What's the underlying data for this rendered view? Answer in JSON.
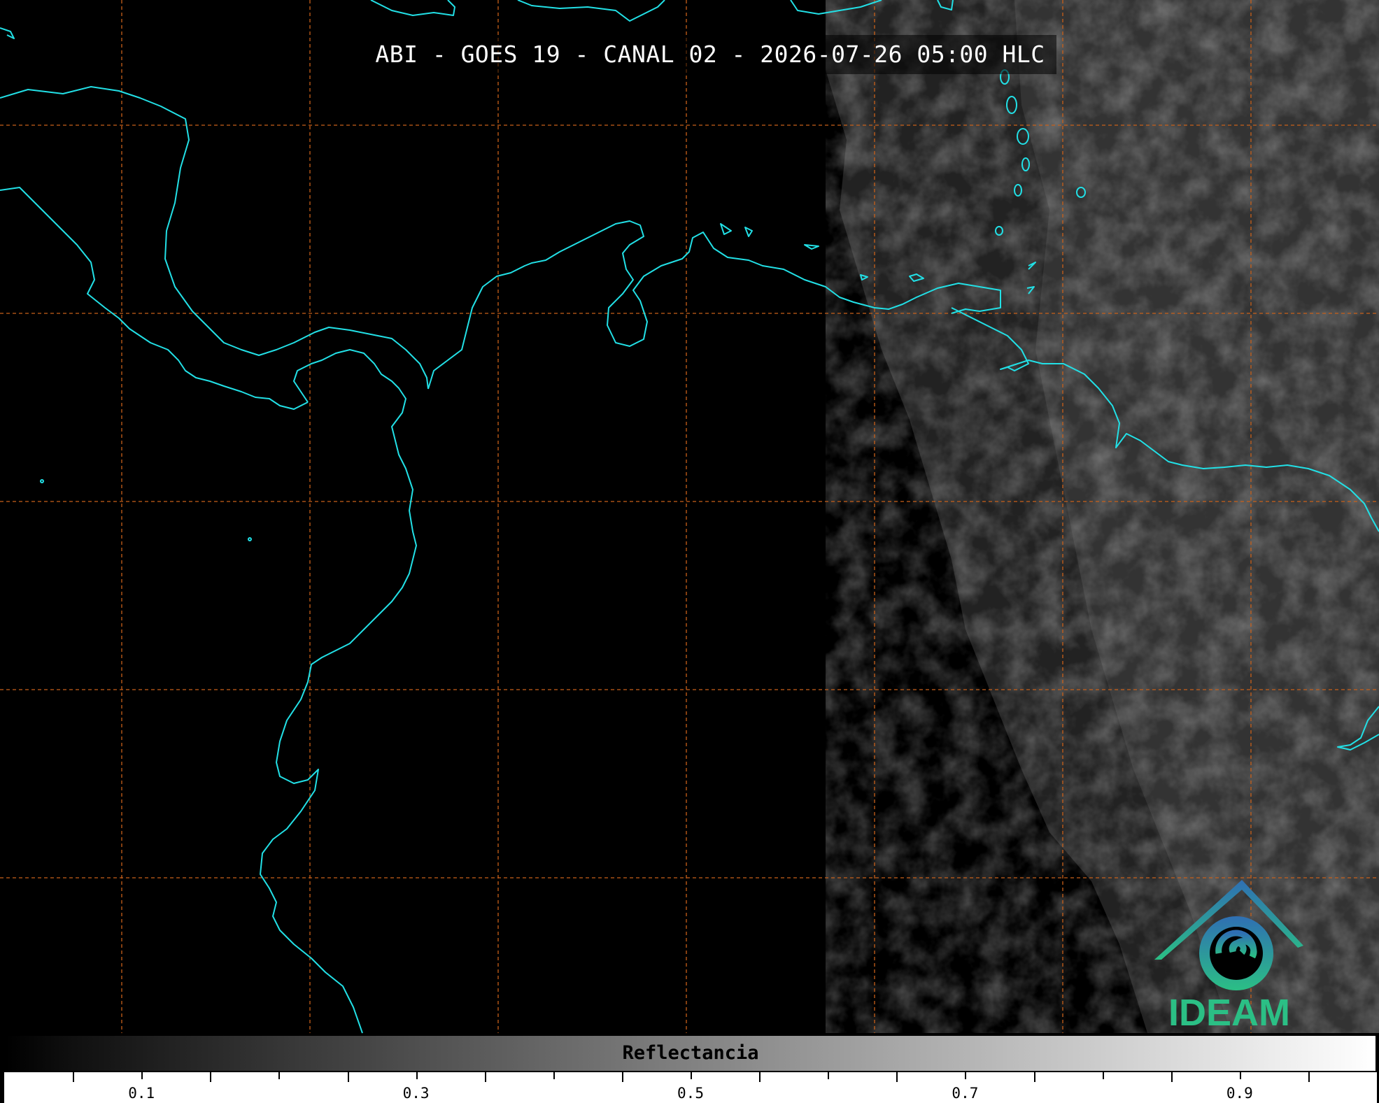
{
  "title": "ABI - GOES 19 - CANAL 02 - 2026-07-26 05:00 HLC",
  "colorbar": {
    "label": "Reflectancia",
    "tick_labels": [
      "0.1",
      "0.3",
      "0.5",
      "0.7",
      "0.9"
    ]
  },
  "logo": {
    "text": "IDEAM"
  },
  "colors": {
    "coastline": "#22e0e6",
    "graticule": "#c8601a",
    "background": "#000000",
    "logo_top": "#2f6fb3",
    "logo_bottom": "#2bbf85"
  }
}
